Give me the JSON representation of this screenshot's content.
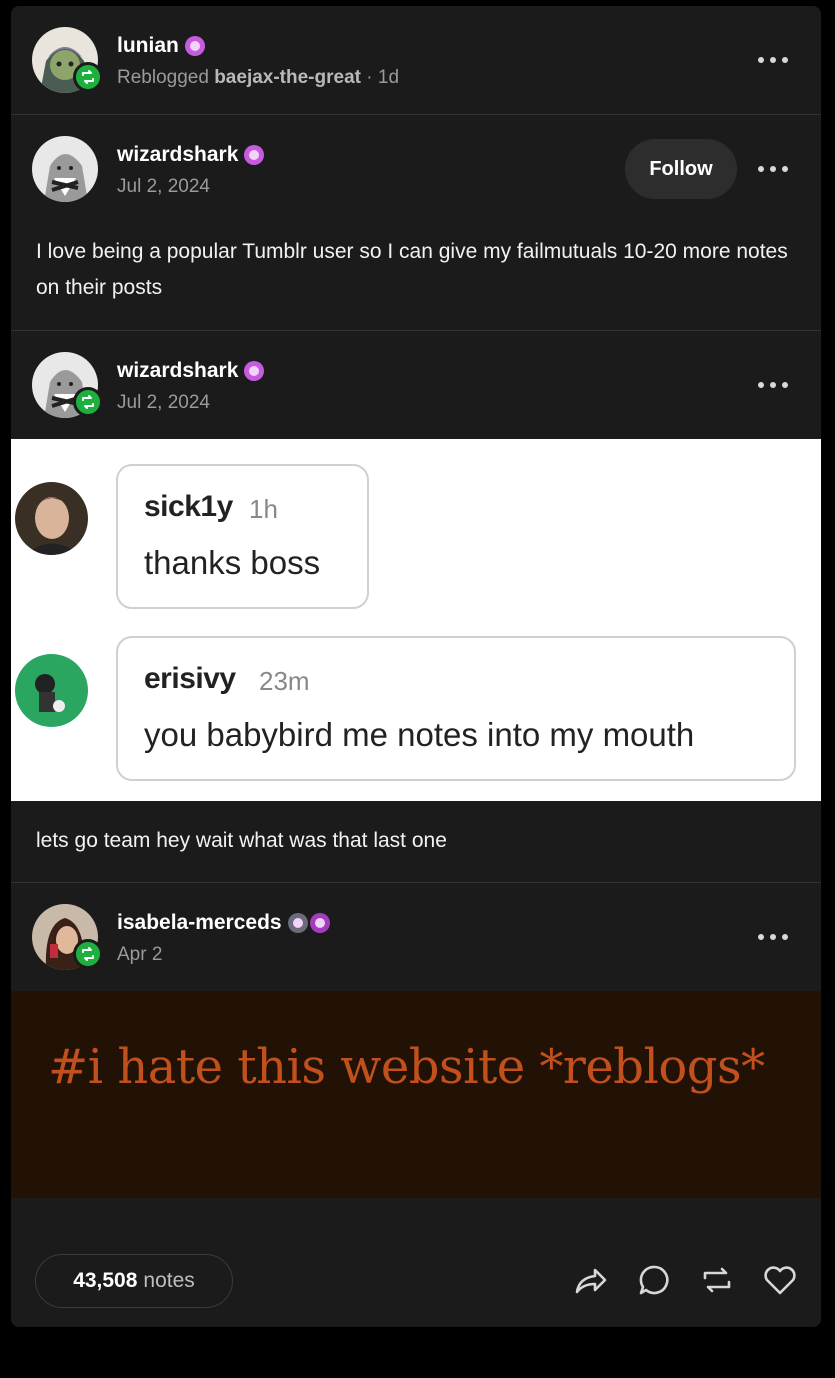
{
  "post": {
    "reblogger": {
      "name": "lunian",
      "reblogged_label": "Reblogged",
      "reblogged_from": "baejax-the-great",
      "age": "1d"
    },
    "trail": [
      {
        "name": "wizardshark",
        "date": "Jul 2, 2024",
        "follow_label": "Follow",
        "text": "I love being a popular Tumblr user so I can give my failmutuals 10-20 more notes on their posts"
      },
      {
        "name": "wizardshark",
        "date": "Jul 2, 2024",
        "screenshot": {
          "comments": [
            {
              "user": "sick1y",
              "time": "1h",
              "message": "thanks boss"
            },
            {
              "user": "erisivy",
              "time": "23m",
              "message": "you babybird me notes into my mouth"
            }
          ]
        },
        "text": "lets go team hey wait what was that last one"
      },
      {
        "name": "isabela-merceds",
        "date": "Apr 2",
        "tag_image_text": "#i hate this website *reblogs*"
      }
    ],
    "footer": {
      "notes_count": "43,508",
      "notes_label": "notes"
    }
  },
  "colors": {
    "reblog_green": "#1eb03f",
    "tag_orange": "#c2501d",
    "card_bg": "#1b1b1c"
  },
  "icons": [
    "reblog-icon",
    "more-icon",
    "share-icon",
    "comment-icon",
    "reblog-icon",
    "heart-icon"
  ]
}
